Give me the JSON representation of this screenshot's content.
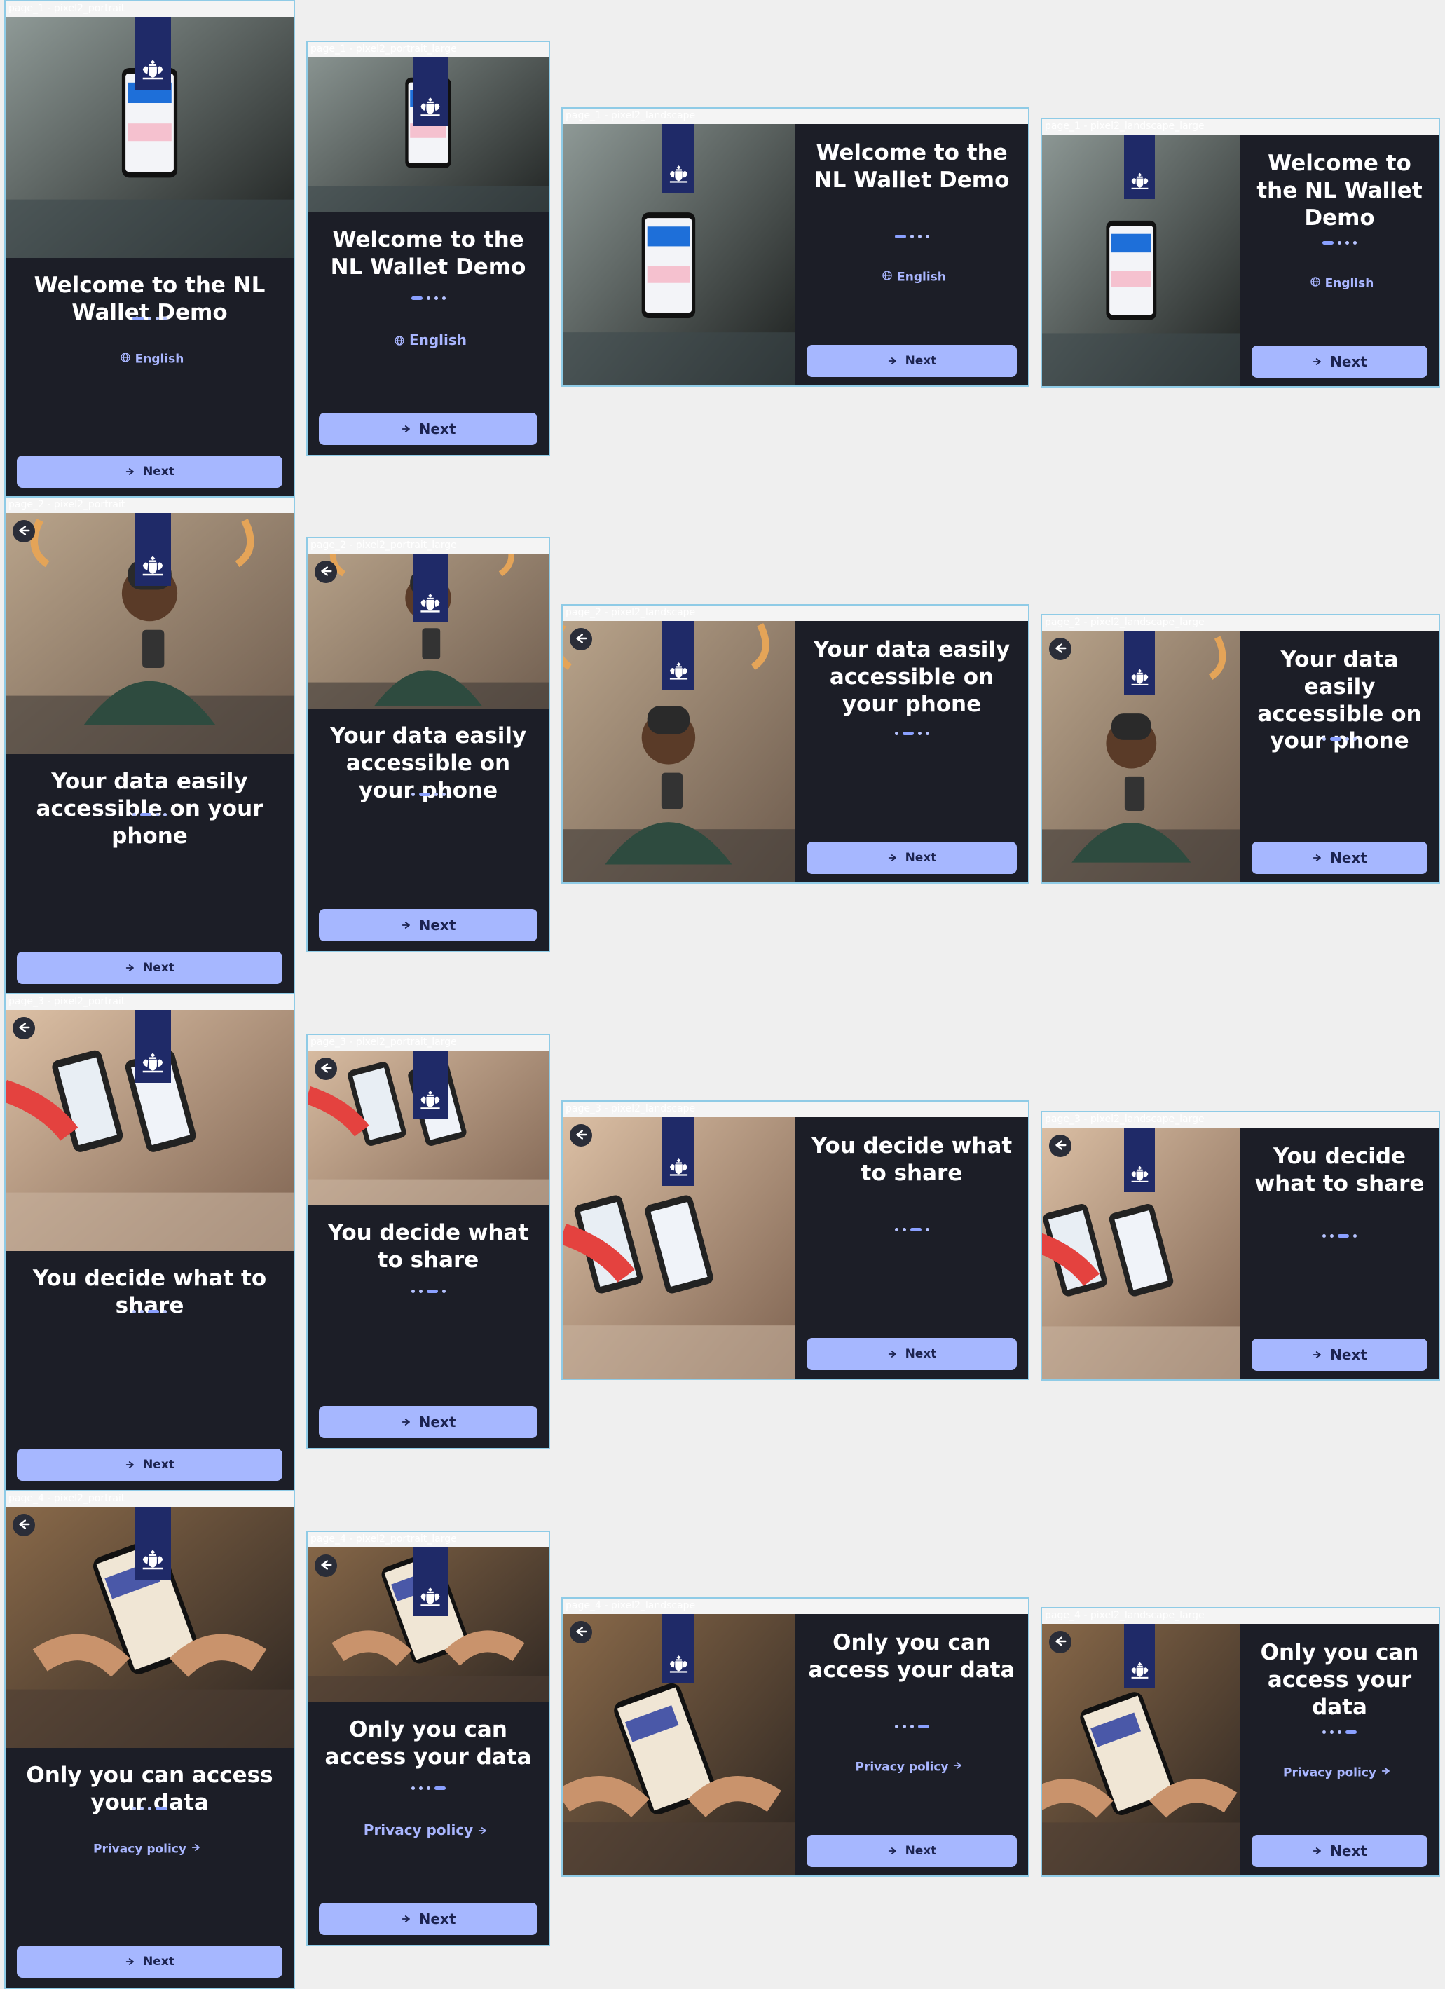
{
  "labels": {
    "portrait": "page_{n} - pixel2_portrait",
    "portrait_large": "page_{n} - pixel2_portrait_large",
    "landscape": "page_{n} - pixel2_landscape",
    "landscape_large": "page_{n} - pixel2_landscape_large"
  },
  "actions": {
    "next": "Next",
    "language": "English",
    "privacy": "Privacy policy"
  },
  "colors": {
    "screen_bg": "#1c1e27",
    "emblem": "#1f2a68",
    "button": "#a6b7ff",
    "link": "#a9b6ff",
    "frame_border": "#8fcbe6"
  },
  "icons": {
    "next": "arrow-right-icon",
    "language": "globe-icon",
    "privacy": "arrow-right-icon",
    "back": "arrow-left-icon",
    "emblem": "royal-coat-of-arms-icon"
  },
  "pages": [
    {
      "n": 1,
      "title": "Welcome to the NL Wallet Demo",
      "active_dot": 0,
      "has_back": false,
      "extra": "language"
    },
    {
      "n": 2,
      "title": "Your data easily accessible on your phone",
      "active_dot": 1,
      "has_back": true,
      "extra": null
    },
    {
      "n": 3,
      "title": "You decide what to share",
      "active_dot": 2,
      "has_back": true,
      "extra": null
    },
    {
      "n": 4,
      "title": "Only you can access your data",
      "active_dot": 3,
      "has_back": true,
      "extra": "privacy"
    }
  ]
}
